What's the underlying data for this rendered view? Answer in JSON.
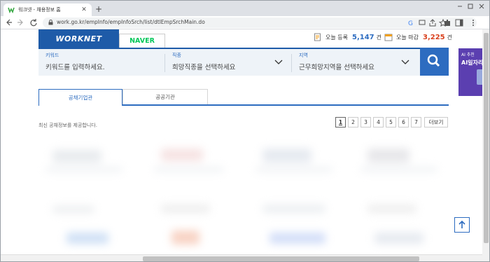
{
  "browser": {
    "tab_title": "워크넷 - 채용정보 홈",
    "url": "work.go.kr/empInfo/empInfoSrch/list/dtlEmpSrchMain.do",
    "new_tab": "+",
    "close": "✕"
  },
  "header": {
    "logo_text": "WORKNET",
    "naver_label": "NAVER",
    "today_register_label": "오늘 등록",
    "today_register_count": "5,147",
    "today_register_unit": "건",
    "today_deadline_label": "오늘 마감",
    "today_deadline_count": "3,225",
    "today_deadline_unit": "건"
  },
  "search": {
    "keyword_label": "키워드",
    "keyword_placeholder": "키워드를 입력하세요.",
    "job_label": "직종",
    "job_value": "희망직종을 선택하세요",
    "region_label": "지역",
    "region_value": "근무희망지역을 선택하세요"
  },
  "ad": {
    "line1": "AI 추천",
    "line2": "AI일자리"
  },
  "tabs": [
    {
      "label": "공채기업관"
    },
    {
      "label": "공공기관"
    }
  ],
  "notice": "최신 공채정보를 제공합니다.",
  "pagination": {
    "pages": [
      "1",
      "2",
      "3",
      "4",
      "5",
      "6",
      "7"
    ],
    "more": "더보기"
  },
  "colors": {
    "brand": "#1e5ba8",
    "accent": "#2d6cc0",
    "register_count": "#2d6cc0",
    "deadline_count": "#d9411e"
  }
}
